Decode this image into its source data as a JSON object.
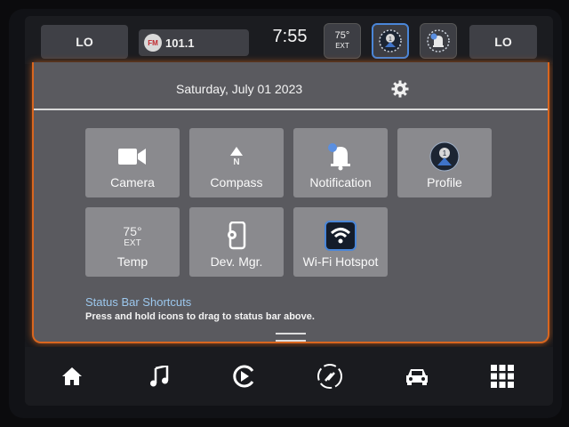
{
  "status_bar": {
    "temp_left": "LO",
    "radio_band": "FM",
    "radio_freq": "101.1",
    "clock": "7:55",
    "ext_temp": "75°",
    "ext_label": "EXT",
    "temp_right": "LO"
  },
  "panel": {
    "date": "Saturday, July 01 2023",
    "tiles": [
      {
        "label": "Camera",
        "icon": "camera-icon"
      },
      {
        "label": "Compass",
        "icon": "compass-icon",
        "glyph": "N"
      },
      {
        "label": "Notification",
        "icon": "bell-icon"
      },
      {
        "label": "Profile",
        "icon": "profile-icon"
      },
      {
        "label": "Temp",
        "icon": "temp-icon",
        "value": "75°",
        "sub": "EXT"
      },
      {
        "label": "Dev. Mgr.",
        "icon": "device-manager-icon"
      },
      {
        "label": "Wi-Fi Hotspot",
        "icon": "wifi-icon"
      }
    ],
    "shortcuts_title": "Status Bar Shortcuts",
    "shortcuts_hint": "Press and hold icons to drag to status bar above."
  },
  "nav_bar": {
    "items": [
      "home-icon",
      "music-icon",
      "media-play-icon",
      "sirius-icon",
      "vehicle-icon",
      "apps-grid-icon"
    ]
  },
  "colors": {
    "accent_orange": "#d9661f",
    "link_blue": "#9cc8ee",
    "tile_gray": "#8a8a8e",
    "panel_gray": "#5a5a5f"
  }
}
